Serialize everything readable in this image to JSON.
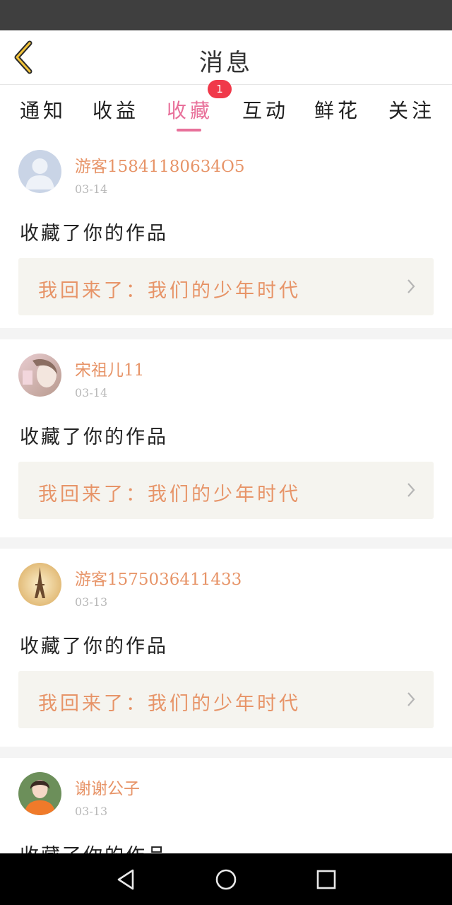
{
  "header": {
    "title": "消息"
  },
  "tabs": [
    {
      "label": "通知"
    },
    {
      "label": "收益"
    },
    {
      "label": "收藏",
      "active": true,
      "badge": "1"
    },
    {
      "label": "互动"
    },
    {
      "label": "鲜花"
    },
    {
      "label": "关注"
    }
  ],
  "colors": {
    "accent": "#e8709a",
    "orange": "#e79468",
    "badge": "#f0394a"
  },
  "items": [
    {
      "username": "游客15841180634O5",
      "date": "03-14",
      "action": "收藏了你的作品",
      "work": "我回来了：我们的少年时代",
      "avatar": "default-avatar"
    },
    {
      "username": "宋祖儿11",
      "date": "03-14",
      "action": "收藏了你的作品",
      "work": "我回来了：我们的少年时代",
      "avatar": "photo-avatar"
    },
    {
      "username": "游客1575036411433",
      "date": "03-13",
      "action": "收藏了你的作品",
      "work": "我回来了：我们的少年时代",
      "avatar": "eiffel-avatar"
    },
    {
      "username": "谢谢公子",
      "date": "03-13",
      "action": "收藏了你的作品",
      "avatar": "girl-avatar"
    }
  ],
  "navbar": {
    "icons": [
      "back-triangle-icon",
      "home-circle-icon",
      "recents-square-icon"
    ]
  }
}
